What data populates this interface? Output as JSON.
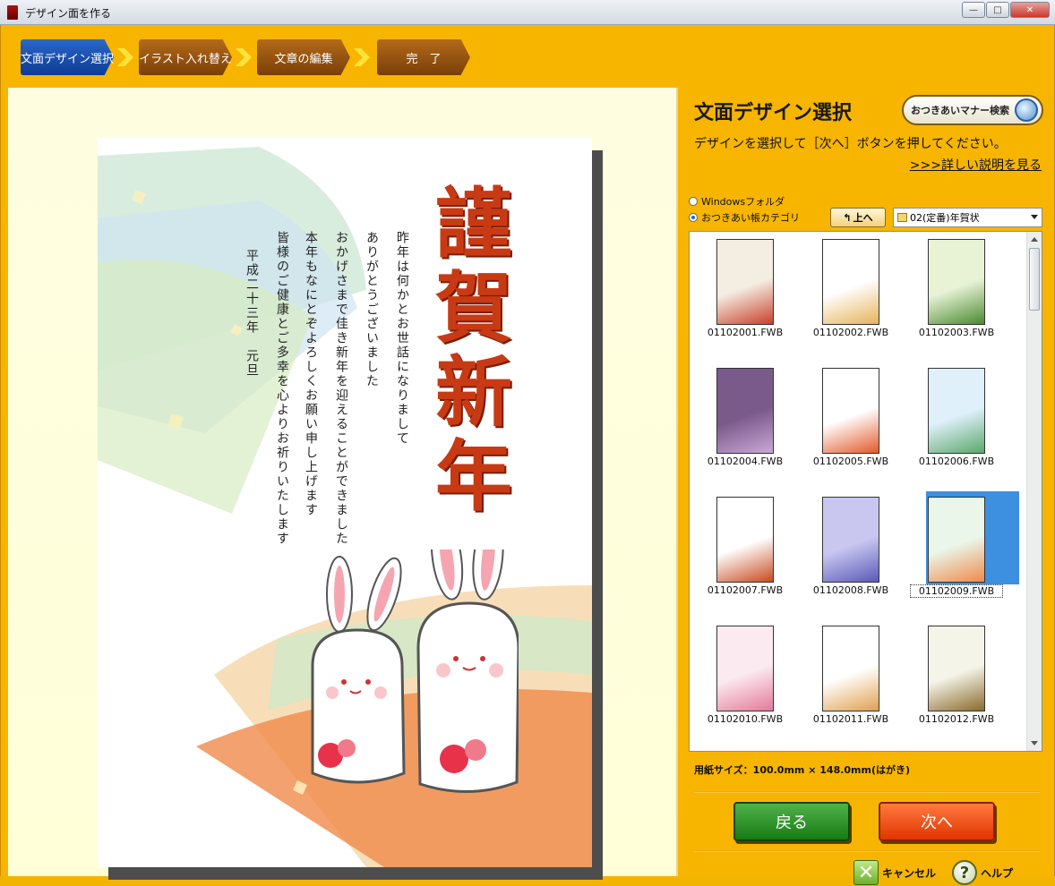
{
  "window": {
    "title": "デザイン面を作る",
    "buttons": {
      "minimize": "—",
      "maximize": "□",
      "close": "✕"
    }
  },
  "steps": [
    {
      "label": "文面デザイン選択",
      "state": "active"
    },
    {
      "label": "イラスト入れ替え",
      "state": "inactive"
    },
    {
      "label": "文章の編集",
      "state": "inactive"
    },
    {
      "label": "完　了",
      "state": "inactive"
    }
  ],
  "preview": {
    "heading_chars": [
      "謹",
      "賀",
      "新",
      "年"
    ],
    "body_lines": [
      "昨年は何かとお世話になりまして",
      "ありがとうございました",
      "おかげさまで佳き新年を迎えることができました",
      "本年もなにとぞよろしくお願い申し上げます",
      "皆様のご健康とご多幸を心よりお祈りいたします",
      "平成二十三年　元旦"
    ]
  },
  "panel": {
    "title": "文面デザイン選択",
    "manner_search_label": "おつきあいマナー検索",
    "instructions": "デザインを選択して［次へ］ボタンを押してください。",
    "detail_link": ">>>詳しい説明を見る",
    "source_options": [
      {
        "label": "Windowsフォルダ",
        "selected": false
      },
      {
        "label": "おつきあい帳カテゴリ",
        "selected": true
      }
    ],
    "up_button_label": "上へ",
    "folder_selected": "02(定番)年賀状",
    "thumbnails": [
      {
        "label": "01102001.FWB"
      },
      {
        "label": "01102002.FWB"
      },
      {
        "label": "01102003.FWB"
      },
      {
        "label": "01102004.FWB"
      },
      {
        "label": "01102005.FWB"
      },
      {
        "label": "01102006.FWB"
      },
      {
        "label": "01102007.FWB"
      },
      {
        "label": "01102008.FWB"
      },
      {
        "label": "01102009.FWB",
        "selected": true
      },
      {
        "label": "01102010.FWB"
      },
      {
        "label": "01102011.FWB"
      },
      {
        "label": "01102012.FWB"
      }
    ],
    "paper_size": "用紙サイズ：100.0mm × 148.0mm(はがき)",
    "back_label": "戻る",
    "next_label": "次へ",
    "cancel_label": "キャンセル",
    "help_label": "ヘルプ"
  },
  "colors": {
    "frame": "#f7b500",
    "active_step": "#1a4aa8",
    "inactive_step": "#9a5512",
    "back_button": "#2e8f2a",
    "next_button": "#f05010",
    "selection": "#3d8fe0"
  }
}
